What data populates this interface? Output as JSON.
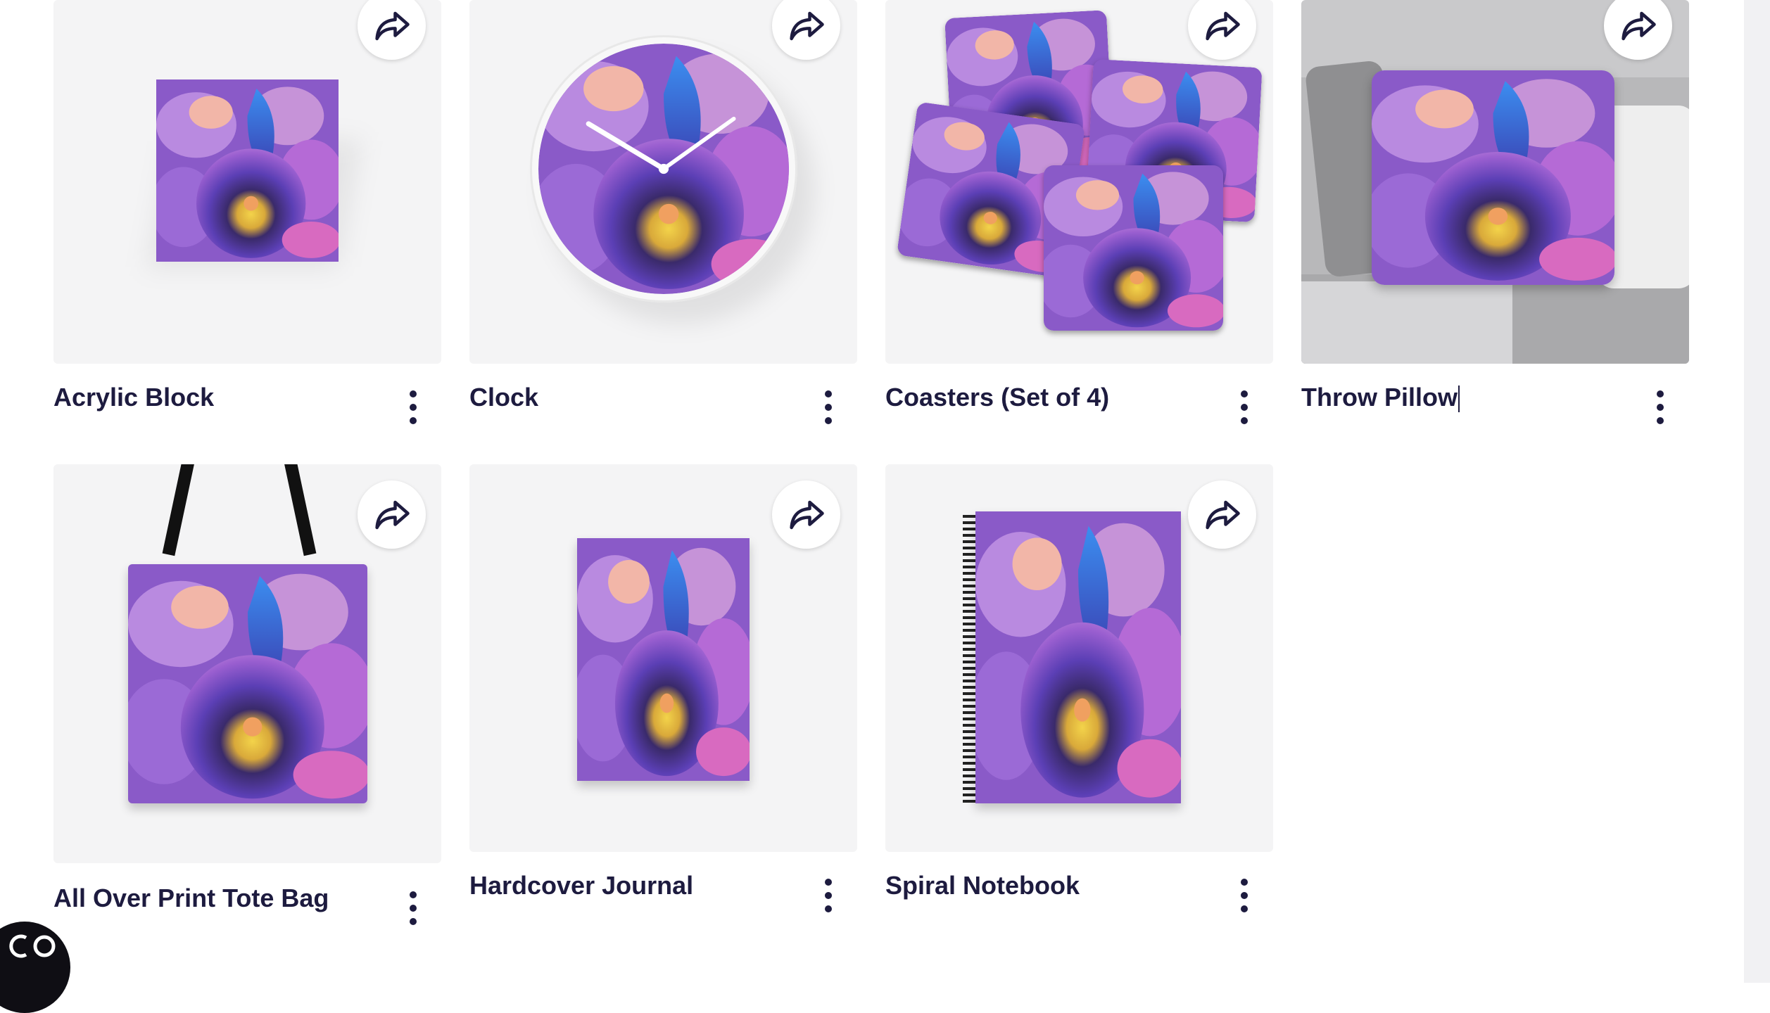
{
  "colors": {
    "text": "#1d1b3f",
    "thumb_bg": "#f4f4f5",
    "accent_purple": "#7a4fc8",
    "accent_blue": "#2f6fe0",
    "accent_yellow": "#e6c93a"
  },
  "share_icon": "share-forward-icon",
  "more_icon": "more-vertical-icon",
  "products": [
    {
      "id": "acrylic-block",
      "title": "Acrylic Block"
    },
    {
      "id": "clock",
      "title": "Clock"
    },
    {
      "id": "coasters",
      "title": "Coasters (Set of 4)"
    },
    {
      "id": "throw-pillow",
      "title": "Throw Pillow"
    },
    {
      "id": "tote-bag",
      "title": "All Over Print Tote Bag"
    },
    {
      "id": "hardcover-journal",
      "title": "Hardcover Journal"
    },
    {
      "id": "spiral-notebook",
      "title": "Spiral Notebook"
    }
  ],
  "corner_badge_icon": "cc-logo-icon"
}
